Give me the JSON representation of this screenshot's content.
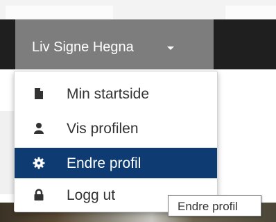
{
  "navbar": {
    "user_name": "Liv Signe Hegna"
  },
  "menu": {
    "items": [
      {
        "label": "Min startside",
        "icon": "file-icon"
      },
      {
        "label": "Vis profilen",
        "icon": "user-icon"
      },
      {
        "label": "Endre profil",
        "icon": "gear-icon",
        "active": true
      },
      {
        "label": "Logg ut",
        "icon": "lock-icon"
      }
    ]
  },
  "tooltip": {
    "text": "Endre profil"
  },
  "colors": {
    "navbar_bg": "#1f1f1f",
    "toggle_bg": "#7d7d7d",
    "active_item_bg": "#0d3b72"
  }
}
